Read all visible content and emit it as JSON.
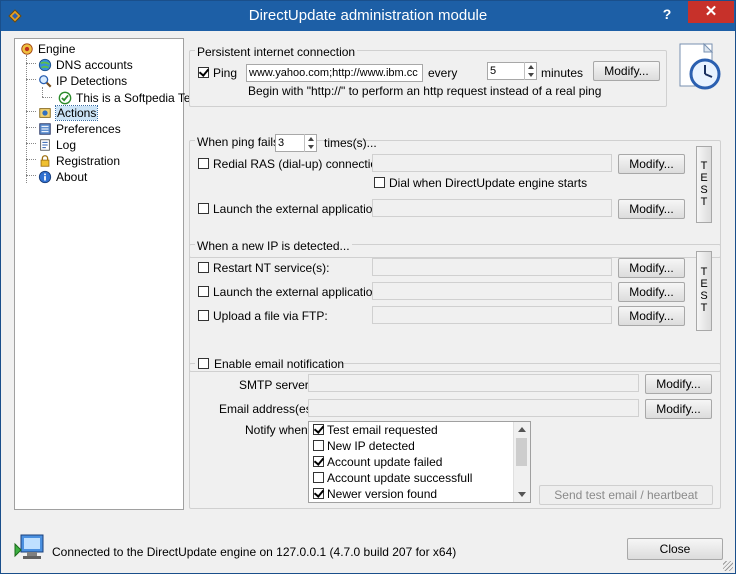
{
  "window": {
    "title": "DirectUpdate administration module",
    "help_label": "?",
    "close_label": "✕"
  },
  "tree": {
    "items": [
      {
        "label": "Engine",
        "icon": "engine-icon"
      },
      {
        "label": "DNS accounts",
        "icon": "globe-icon"
      },
      {
        "label": "IP Detections",
        "icon": "search-icon"
      },
      {
        "label": "This is a Softpedia Te",
        "icon": "check-circle-icon"
      },
      {
        "label": "Actions",
        "icon": "actions-icon"
      },
      {
        "label": "Preferences",
        "icon": "preferences-icon"
      },
      {
        "label": "Log",
        "icon": "log-icon"
      },
      {
        "label": "Registration",
        "icon": "lock-icon"
      },
      {
        "label": "About",
        "icon": "info-icon"
      }
    ]
  },
  "persistent": {
    "title": "Persistent internet connection",
    "ping_label": "Ping",
    "ping_checked": true,
    "ping_value": "www.yahoo.com;http://www.ibm.cc",
    "every_label": "every",
    "minutes_value": "5",
    "minutes_label": "minutes",
    "modify_label": "Modify...",
    "hint": "Begin with \"http://\" to perform an http request instead of a real ping"
  },
  "ping_fails": {
    "title": "When ping fails",
    "times_value": "3",
    "times_label": "times(s)...",
    "redial_label": "Redial RAS (dial-up) connection:",
    "redial_checked": false,
    "redial_modify": "Modify...",
    "dial_label": "Dial when DirectUpdate engine starts",
    "dial_checked": false,
    "launch_label": "Launch the external application:",
    "launch_checked": false,
    "launch_modify": "Modify...",
    "test_label": [
      "T",
      "E",
      "S",
      "T"
    ]
  },
  "new_ip": {
    "title": "When a new IP is detected...",
    "restart_label": "Restart NT service(s):",
    "restart_modify": "Modify...",
    "launch_label": "Launch the external application:",
    "launch_modify": "Modify...",
    "upload_label": "Upload a file via FTP:",
    "upload_modify": "Modify...",
    "test_label": [
      "T",
      "E",
      "S",
      "T"
    ]
  },
  "email": {
    "enable_label": "Enable email notification",
    "enable_checked": false,
    "smtp_label": "SMTP server:",
    "smtp_modify": "Modify...",
    "address_label": "Email address(es):",
    "address_modify": "Modify...",
    "notify_label": "Notify when:",
    "notify_items": [
      {
        "label": "Test email requested",
        "checked": true
      },
      {
        "label": "New IP detected",
        "checked": false
      },
      {
        "label": "Account update failed",
        "checked": true
      },
      {
        "label": "Account update successfull",
        "checked": false
      },
      {
        "label": "Newer version found",
        "checked": true
      }
    ],
    "send_test_label": "Send test email / heartbeat"
  },
  "status": {
    "text": "Connected to the DirectUpdate engine on 127.0.0.1 (4.7.0 build 207 for x64)",
    "close_label": "Close"
  }
}
